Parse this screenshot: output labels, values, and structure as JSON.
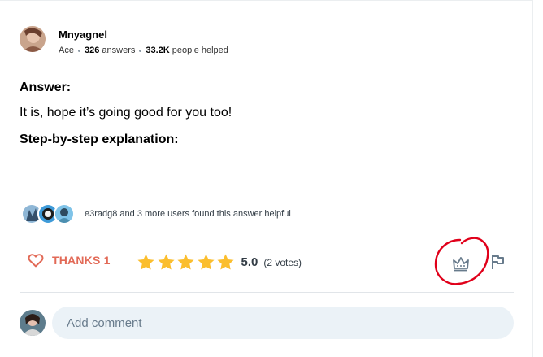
{
  "author": {
    "name": "Mnyagnel",
    "rank": "Ace",
    "answers_count": "326",
    "answers_label": "answers",
    "helped_count": "33.2K",
    "helped_label": "people helped"
  },
  "answer": {
    "heading": "Answer:",
    "text": "It is, hope it’s going good for you too!",
    "step_heading": "Step-by-step explanation:"
  },
  "helpful": {
    "text": "e3radg8 and 3 more users found this answer helpful"
  },
  "actions": {
    "thanks_label": "THANKS 1",
    "rating_value": "5.0",
    "rating_stars": 5,
    "votes": "(2 votes)"
  },
  "comment": {
    "placeholder": "Add comment"
  },
  "colors": {
    "thanks": "#e26a57",
    "star": "#fbbe2e",
    "icon": "#687b8c",
    "annotation": "#e0001a"
  }
}
